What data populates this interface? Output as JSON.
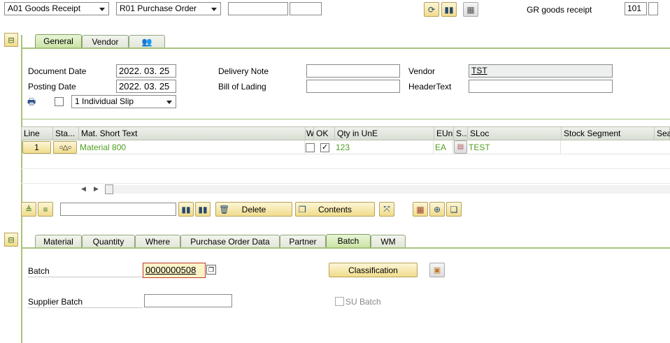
{
  "header": {
    "action": "A01 Goods Receipt",
    "reference": "R01 Purchase Order",
    "ref_number": "",
    "ref_item": "",
    "movement_label": "GR goods receipt",
    "movement_type": "101",
    "movement_extra": ""
  },
  "header_tabs": [
    {
      "label": "General"
    },
    {
      "label": "Vendor"
    },
    {
      "label": ""
    }
  ],
  "general": {
    "document_date_label": "Document Date",
    "document_date": "2022. 03. 25",
    "posting_date_label": "Posting Date",
    "posting_date": "2022. 03. 25",
    "delivery_note_label": "Delivery Note",
    "delivery_note": "",
    "bill_of_lading_label": "Bill of Lading",
    "bill_of_lading": "",
    "vendor_label": "Vendor",
    "vendor": "TST",
    "header_text_label": "HeaderText",
    "header_text": "",
    "slip": "1 Individual Slip"
  },
  "items_table": {
    "columns": [
      "Line",
      "Sta...",
      "Mat. Short Text",
      "W",
      "OK",
      "Qty in UnE",
      "EUn",
      "S...",
      "SLoc",
      "Stock Segment",
      "Sea"
    ],
    "rows": [
      {
        "line": "1",
        "material": "Material 800",
        "ok": "✓",
        "qty": "123",
        "unit": "EA",
        "sloc": "TEST"
      }
    ]
  },
  "item_toolbar": {
    "search": "",
    "delete_label": "Delete",
    "contents_label": "Contents"
  },
  "detail_tabs": [
    {
      "label": "Material"
    },
    {
      "label": "Quantity"
    },
    {
      "label": "Where"
    },
    {
      "label": "Purchase Order Data"
    },
    {
      "label": "Partner"
    },
    {
      "label": "Batch"
    },
    {
      "label": "WM"
    }
  ],
  "batch": {
    "batch_label": "Batch",
    "batch_value": "0000000508",
    "supplier_batch_label": "Supplier Batch",
    "supplier_batch": "",
    "classification_label": "Classification",
    "su_batch_label": "SU Batch"
  },
  "colors": {
    "accent_green": "#4f9e20",
    "tab_active": "#c9e3a3",
    "button_yellow": "#f0dc8c"
  }
}
